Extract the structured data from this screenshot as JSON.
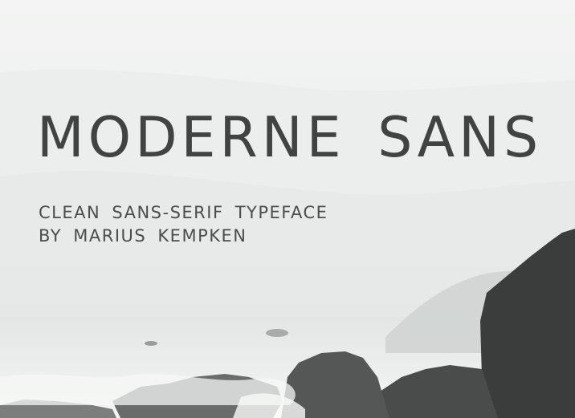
{
  "title": "MODERNE SANS",
  "subtitle_line1": "CLEAN SANS-SERIF TYPEFACE",
  "subtitle_line2": "BY MARIUS KEMPKEN",
  "colors": {
    "sky": "#f0f1f0",
    "text": "#404342",
    "rock_dark": "#3a3c3c",
    "mist": "#d6d9d8"
  }
}
